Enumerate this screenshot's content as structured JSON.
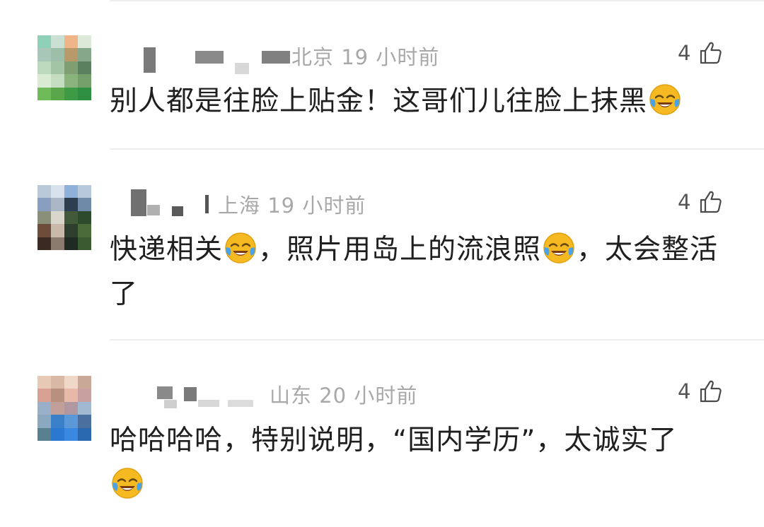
{
  "comments": [
    {
      "location": "北京",
      "time": "19 小时前",
      "likes": "4",
      "text_parts": [
        "别人都是往脸上贴金！这哥们儿往脸上抹黑"
      ],
      "emoji": "face-with-tears-of-joy"
    },
    {
      "location": "上海",
      "time": "19 小时前",
      "likes": "4",
      "text_parts": [
        "快递相关",
        "，照片用岛上的流浪照",
        "，太会整活了"
      ],
      "emoji": "face-with-tears-of-joy"
    },
    {
      "location": "山东",
      "time": "20 小时前",
      "likes": "4",
      "text_parts": [
        "哈哈哈哈，特别说明，“国内学历”，太诚实了"
      ],
      "emoji": "face-with-tears-of-joy"
    }
  ],
  "icons": {
    "like": "thumbs-up-outline-icon",
    "emoji": "face-with-tears-of-joy"
  },
  "colors": {
    "meta_text": "#a8a8a8",
    "body_text": "#1f1f1f",
    "divider": "#eeeeee",
    "emoji_face": "#f5b921"
  }
}
